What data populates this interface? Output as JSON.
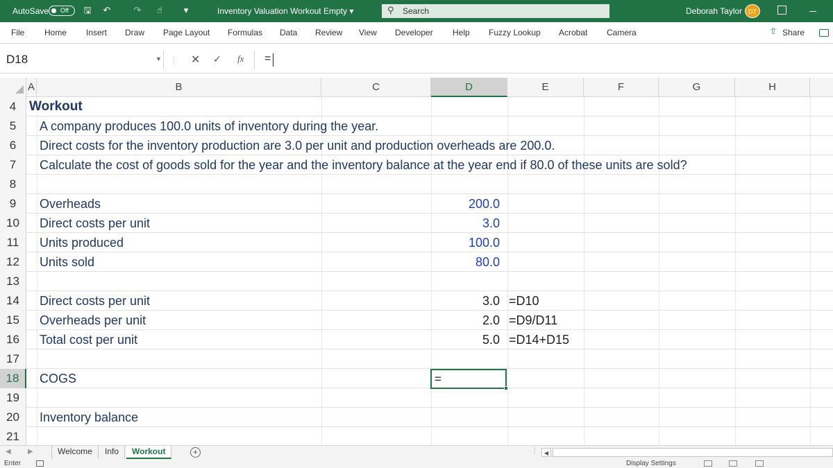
{
  "titlebar": {
    "autosave_label": "AutoSave",
    "autosave_state": "Off",
    "document_title": "Inventory Valuation Workout Empty",
    "search_placeholder": "Search",
    "user_name": "Deborah Taylor",
    "user_initials": "DT",
    "accent_color": "#217346"
  },
  "ribbon_tabs": [
    "File",
    "Home",
    "Insert",
    "Draw",
    "Page Layout",
    "Formulas",
    "Data",
    "Review",
    "View",
    "Developer",
    "Help",
    "Fuzzy Lookup",
    "Acrobat",
    "Camera"
  ],
  "share_label": "Share",
  "formula_bar": {
    "name_box": "D18",
    "formula": "="
  },
  "columns": [
    "A",
    "B",
    "C",
    "D",
    "E",
    "F",
    "G",
    "H"
  ],
  "selected_column": "D",
  "rows": [
    {
      "num": "4",
      "title": "Workout"
    },
    {
      "num": "5",
      "text": "A company produces 100.0 units of inventory during the year."
    },
    {
      "num": "6",
      "text": "Direct costs for the inventory production are 3.0 per unit and production overheads are 200.0."
    },
    {
      "num": "7",
      "text": "Calculate the cost of goods sold for the year and the inventory balance at the year end if 80.0 of these units are sold?"
    },
    {
      "num": "8"
    },
    {
      "num": "9",
      "label": "Overheads",
      "input": "200.0"
    },
    {
      "num": "10",
      "label": "Direct costs per unit",
      "input": "3.0"
    },
    {
      "num": "11",
      "label": "Units produced",
      "input": "100.0"
    },
    {
      "num": "12",
      "label": "Units sold",
      "input": "80.0"
    },
    {
      "num": "13"
    },
    {
      "num": "14",
      "label": "Direct costs per unit",
      "calc": "3.0",
      "formula": "=D10"
    },
    {
      "num": "15",
      "label": "Overheads per unit",
      "calc": "2.0",
      "formula": "=D9/D11"
    },
    {
      "num": "16",
      "label": "Total cost per unit",
      "calc": "5.0",
      "formula": "=D14+D15"
    },
    {
      "num": "17"
    },
    {
      "num": "18",
      "label": "COGS",
      "active_value": "="
    },
    {
      "num": "19"
    },
    {
      "num": "20",
      "label": "Inventory balance"
    },
    {
      "num": "21"
    }
  ],
  "active_row": "18",
  "sheet_tabs": [
    "Welcome",
    "Info",
    "Workout"
  ],
  "active_sheet": "Workout",
  "status": {
    "mode": "Enter",
    "display_settings": "Display Settings"
  }
}
